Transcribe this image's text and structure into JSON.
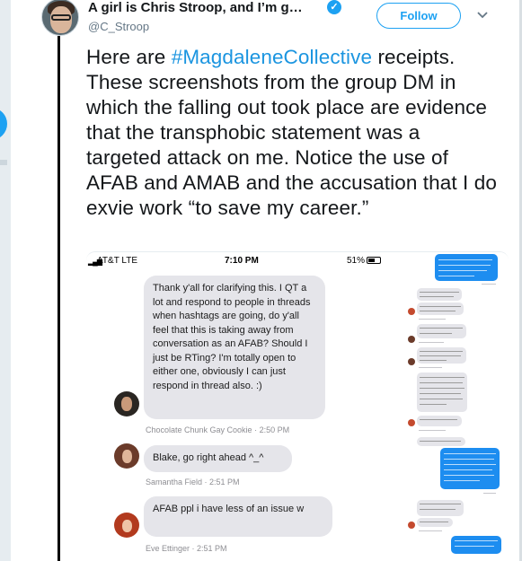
{
  "tweet": {
    "author_name": "A girl is Chris Stroop, and I’m g…",
    "handle": "@C_Stroop",
    "follow_label": "Follow",
    "text_before": "Here are ",
    "hashtag": "#MagdaleneCollective",
    "text_after": " receipts. These screenshots from the group DM in which the falling out took place are evidence that the transphobic statement was a targeted attack on me. Notice the use of AFAB and AMAB and the accusation that I do exvie work “to save my career.”"
  },
  "screenshot": {
    "status": {
      "carrier": "AT&T  LTE",
      "time": "7:10 PM",
      "battery": "51%"
    },
    "messages": [
      {
        "text": "Thank y'all for clarifying this. I QT a lot and respond to people in threads when hashtags are going, do y'all feel that this is taking away from conversation as an AFAB? Should I just be RTing? I'm totally open to either one, obviously I can just respond in thread also. :)",
        "sender": "Chocolate Chunk Gay Cookie · 2:50 PM"
      },
      {
        "text": "Blake, go right ahead ^_^",
        "sender": "Samantha Field · 2:51 PM"
      },
      {
        "text": "AFAB ppl i have less of an issue w",
        "sender": "Eve Ettinger · 2:51 PM"
      }
    ]
  },
  "colors": {
    "accent": "#1da1f2",
    "hashtag": "#1b95e0",
    "imessage_blue": "#1d8df0",
    "bubble_grey": "#e5e5ea"
  },
  "icons": [
    "verified-icon",
    "chevron-down-icon"
  ]
}
